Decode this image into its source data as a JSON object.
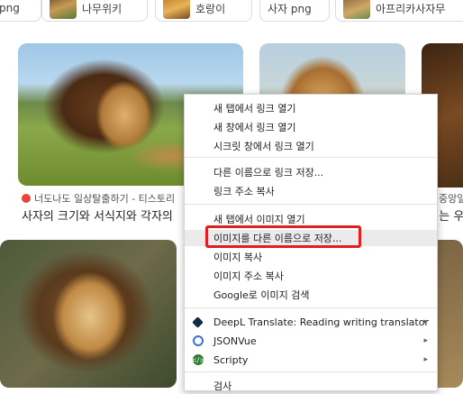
{
  "chips": [
    {
      "label": "png",
      "thumb": ""
    },
    {
      "label": "나무위키",
      "thumb": "lion-thumbnail"
    },
    {
      "label": "호랑이",
      "thumb": "lion-thumbnail"
    },
    {
      "label": "사자 png",
      "thumb": ""
    },
    {
      "label": "아프리카사자무",
      "thumb": "lion-thumbnail"
    }
  ],
  "results": {
    "card1": {
      "source": "너도나도 일상탈출하기 - 티스토리",
      "title": "사자의 크기와 서식지와 각자의"
    },
    "card_right": {
      "source": "중앙일",
      "title": "1는 우"
    }
  },
  "context_menu": {
    "items": [
      {
        "label": "새 탭에서 링크 열기"
      },
      {
        "label": "새 창에서 링크 열기"
      },
      {
        "label": "시크릿 창에서 링크 열기"
      },
      {
        "label": "다른 이름으로 링크 저장..."
      },
      {
        "label": "링크 주소 복사"
      },
      {
        "label": "새 탭에서 이미지 열기"
      },
      {
        "label": "이미지를 다른 이름으로 저장...",
        "highlighted": true
      },
      {
        "label": "이미지 복사"
      },
      {
        "label": "이미지 주소 복사"
      },
      {
        "label": "Google로 이미지 검색"
      },
      {
        "label": "DeepL Translate: Reading  writing translator",
        "icon": "deepl-icon",
        "submenu": true
      },
      {
        "label": "JSONVue",
        "icon": "jsonvue-icon",
        "submenu": true
      },
      {
        "label": "Scripty",
        "icon": "scripty-icon",
        "submenu": true
      },
      {
        "label": "검사"
      }
    ],
    "submenu_arrow": "▸"
  },
  "colors": {
    "highlight_box": "#e02020",
    "menu_hover": "#ebebeb"
  }
}
